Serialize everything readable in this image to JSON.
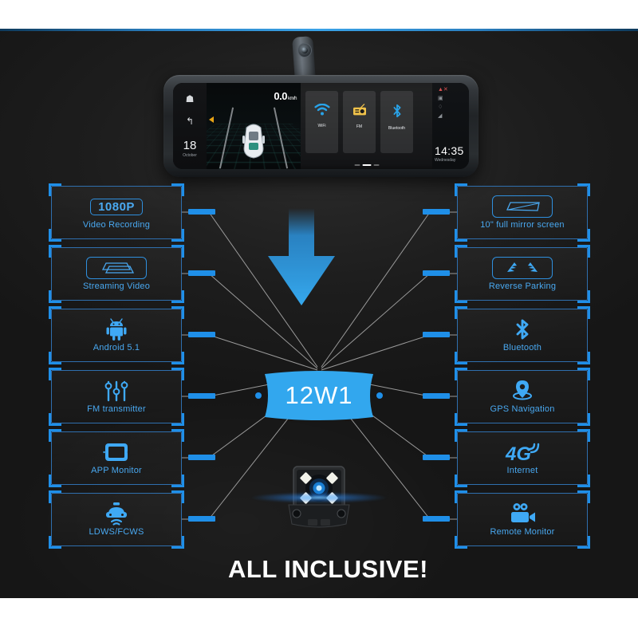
{
  "product": {
    "center_badge": "12W1",
    "tagline": "ALL INCLUSIVE!"
  },
  "device_screen": {
    "home_icon": "home-icon",
    "back_icon": "back-arrow-icon",
    "date_day": "18",
    "date_month": "October",
    "speed_value": "0.0",
    "speed_unit": "km/h",
    "apps": [
      {
        "label": "WiFi",
        "icon": "wifi-icon",
        "color": "#29a3e8"
      },
      {
        "label": "FM",
        "icon": "radio-icon",
        "color": "#f0c24a"
      },
      {
        "label": "Bluetooth",
        "icon": "bluetooth-icon",
        "color": "#29a3e8"
      }
    ],
    "status_icons": [
      "signal-off-icon",
      "sim-card-icon",
      "location-icon",
      "signal-bars-icon"
    ],
    "clock_time": "14:35",
    "clock_weekday": "Wednesday"
  },
  "features_left": [
    {
      "label": "Video Recording",
      "icon": "1080p-badge-icon",
      "badge_text": "1080P"
    },
    {
      "label": "Streaming Video",
      "icon": "streaming-mirror-icon"
    },
    {
      "label": "Android 5.1",
      "icon": "android-robot-icon"
    },
    {
      "label": "FM transmitter",
      "icon": "slider-controls-icon"
    },
    {
      "label": "APP Monitor",
      "icon": "smartphone-icon"
    },
    {
      "label": "LDWS/FCWS",
      "icon": "car-sensor-icon"
    }
  ],
  "features_right": [
    {
      "label": "10\" full mirror screen",
      "icon": "mirror-screen-icon"
    },
    {
      "label": "Reverse Parking",
      "icon": "parking-sensor-icon"
    },
    {
      "label": "Bluetooth",
      "icon": "bluetooth-icon"
    },
    {
      "label": "GPS Navigation",
      "icon": "map-pin-icon"
    },
    {
      "label": "Internet",
      "icon": "4g-signal-icon"
    },
    {
      "label": "Remote Monitor",
      "icon": "video-camera-icon"
    }
  ],
  "colors": {
    "accent_blue": "#1f8fe8",
    "label_blue": "#49a8f0",
    "border_blue": "#2f6fae",
    "badge_blue": "#32a7ee",
    "background_dark": "#1d1d1d"
  }
}
